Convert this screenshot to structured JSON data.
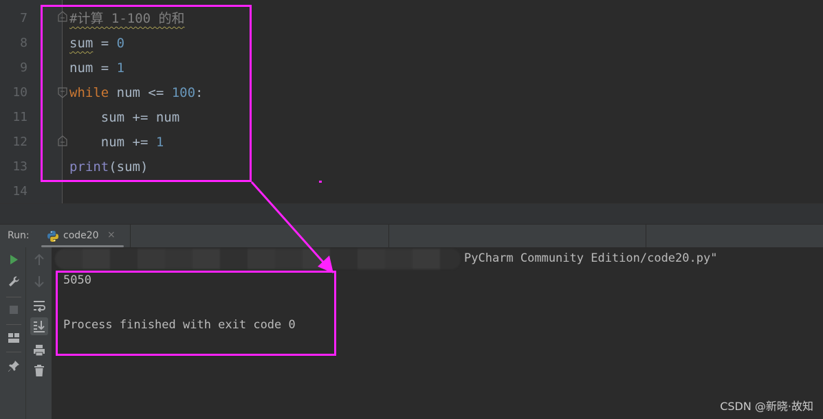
{
  "editor": {
    "line_numbers": [
      "7",
      "8",
      "9",
      "10",
      "11",
      "12",
      "13",
      "14"
    ],
    "lines": [
      {
        "tokens": [
          {
            "t": "#计算 1-100 的和",
            "c": "comment squiggle"
          }
        ]
      },
      {
        "tokens": [
          {
            "t": "sum",
            "c": "squiggle"
          },
          {
            "t": " = ",
            "c": ""
          },
          {
            "t": "0",
            "c": "num"
          }
        ]
      },
      {
        "tokens": [
          {
            "t": "num = ",
            "c": ""
          },
          {
            "t": "1",
            "c": "num"
          }
        ]
      },
      {
        "tokens": [
          {
            "t": "while",
            "c": "kw"
          },
          {
            "t": " num <= ",
            "c": ""
          },
          {
            "t": "100",
            "c": "num"
          },
          {
            "t": ":",
            "c": ""
          }
        ]
      },
      {
        "tokens": [
          {
            "t": "    sum += num",
            "c": ""
          }
        ]
      },
      {
        "tokens": [
          {
            "t": "    num += ",
            "c": ""
          },
          {
            "t": "1",
            "c": "num"
          }
        ]
      },
      {
        "tokens": [
          {
            "t": "print",
            "c": "builtin"
          },
          {
            "t": "(sum)",
            "c": ""
          }
        ]
      },
      {
        "tokens": []
      }
    ]
  },
  "run_panel": {
    "label": "Run:",
    "tab": {
      "name": "code20",
      "icon": "python-icon",
      "close": "×"
    },
    "toolbar_left": [
      "run-icon",
      "wrench-icon",
      "stop-icon",
      "layout-icon",
      "pin-icon"
    ],
    "toolbar_right": [
      "arrow-up-icon",
      "arrow-down-icon",
      "soft-wrap-icon",
      "scroll-to-end-icon",
      "print-icon",
      "trash-icon"
    ]
  },
  "console": {
    "command_tail": "PyCharm Community Edition/code20.py\"",
    "output": "5050",
    "exit_message": "Process finished with exit code 0"
  },
  "colors": {
    "annotation": "#ff22ff",
    "keyword": "#cc7832",
    "number": "#6897bb",
    "builtin": "#8888c6",
    "run_green": "#499c54"
  },
  "watermark": "CSDN @新晓·故知"
}
